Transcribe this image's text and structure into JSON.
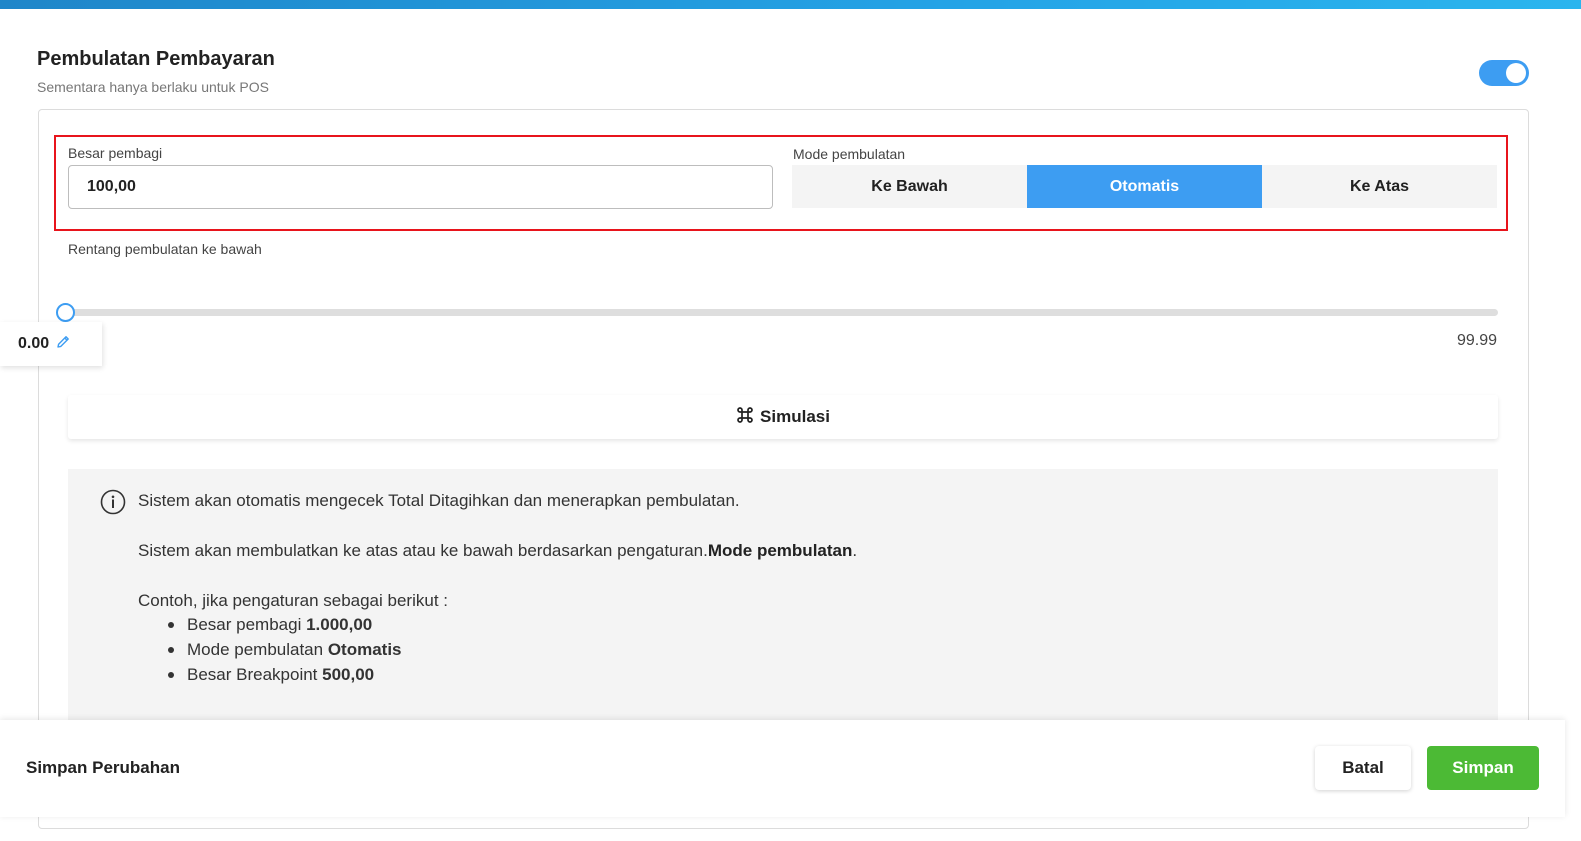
{
  "section": {
    "title": "Pembulatan Pembayaran",
    "subtitle": "Sementara hanya berlaku untuk POS",
    "toggle_on": true
  },
  "divisor": {
    "label": "Besar pembagi",
    "value": "100,00"
  },
  "mode": {
    "label": "Mode pembulatan",
    "options": [
      "Ke Bawah",
      "Otomatis",
      "Ke Atas"
    ],
    "selected": "Otomatis"
  },
  "range": {
    "label": "Rentang pembulatan ke bawah",
    "current": "0.00",
    "max": "99.99"
  },
  "simulation": {
    "label": "Simulasi"
  },
  "info": {
    "line1": "Sistem akan otomatis mengecek Total Ditagihkan dan menerapkan pembulatan.",
    "line2_prefix": "Sistem akan membulatkan ke atas atau ke bawah berdasarkan pengaturan.",
    "line2_bold": "Mode pembulatan",
    "line2_suffix": ".",
    "example_intro": "Contoh, jika pengaturan sebagai berikut :",
    "examples": [
      {
        "text": "Besar pembagi ",
        "bold": "1.000,00"
      },
      {
        "text": "Mode pembulatan ",
        "bold": "Otomatis"
      },
      {
        "text": "Besar Breakpoint ",
        "bold": "500,00"
      }
    ]
  },
  "footer": {
    "title": "Simpan Perubahan",
    "cancel_label": "Batal",
    "save_label": "Simpan"
  },
  "colors": {
    "accent": "#3d9df2",
    "save": "#4cba35",
    "highlight": "#e8141c"
  },
  "icons": [
    "info-icon",
    "pencil-icon",
    "command-icon"
  ]
}
